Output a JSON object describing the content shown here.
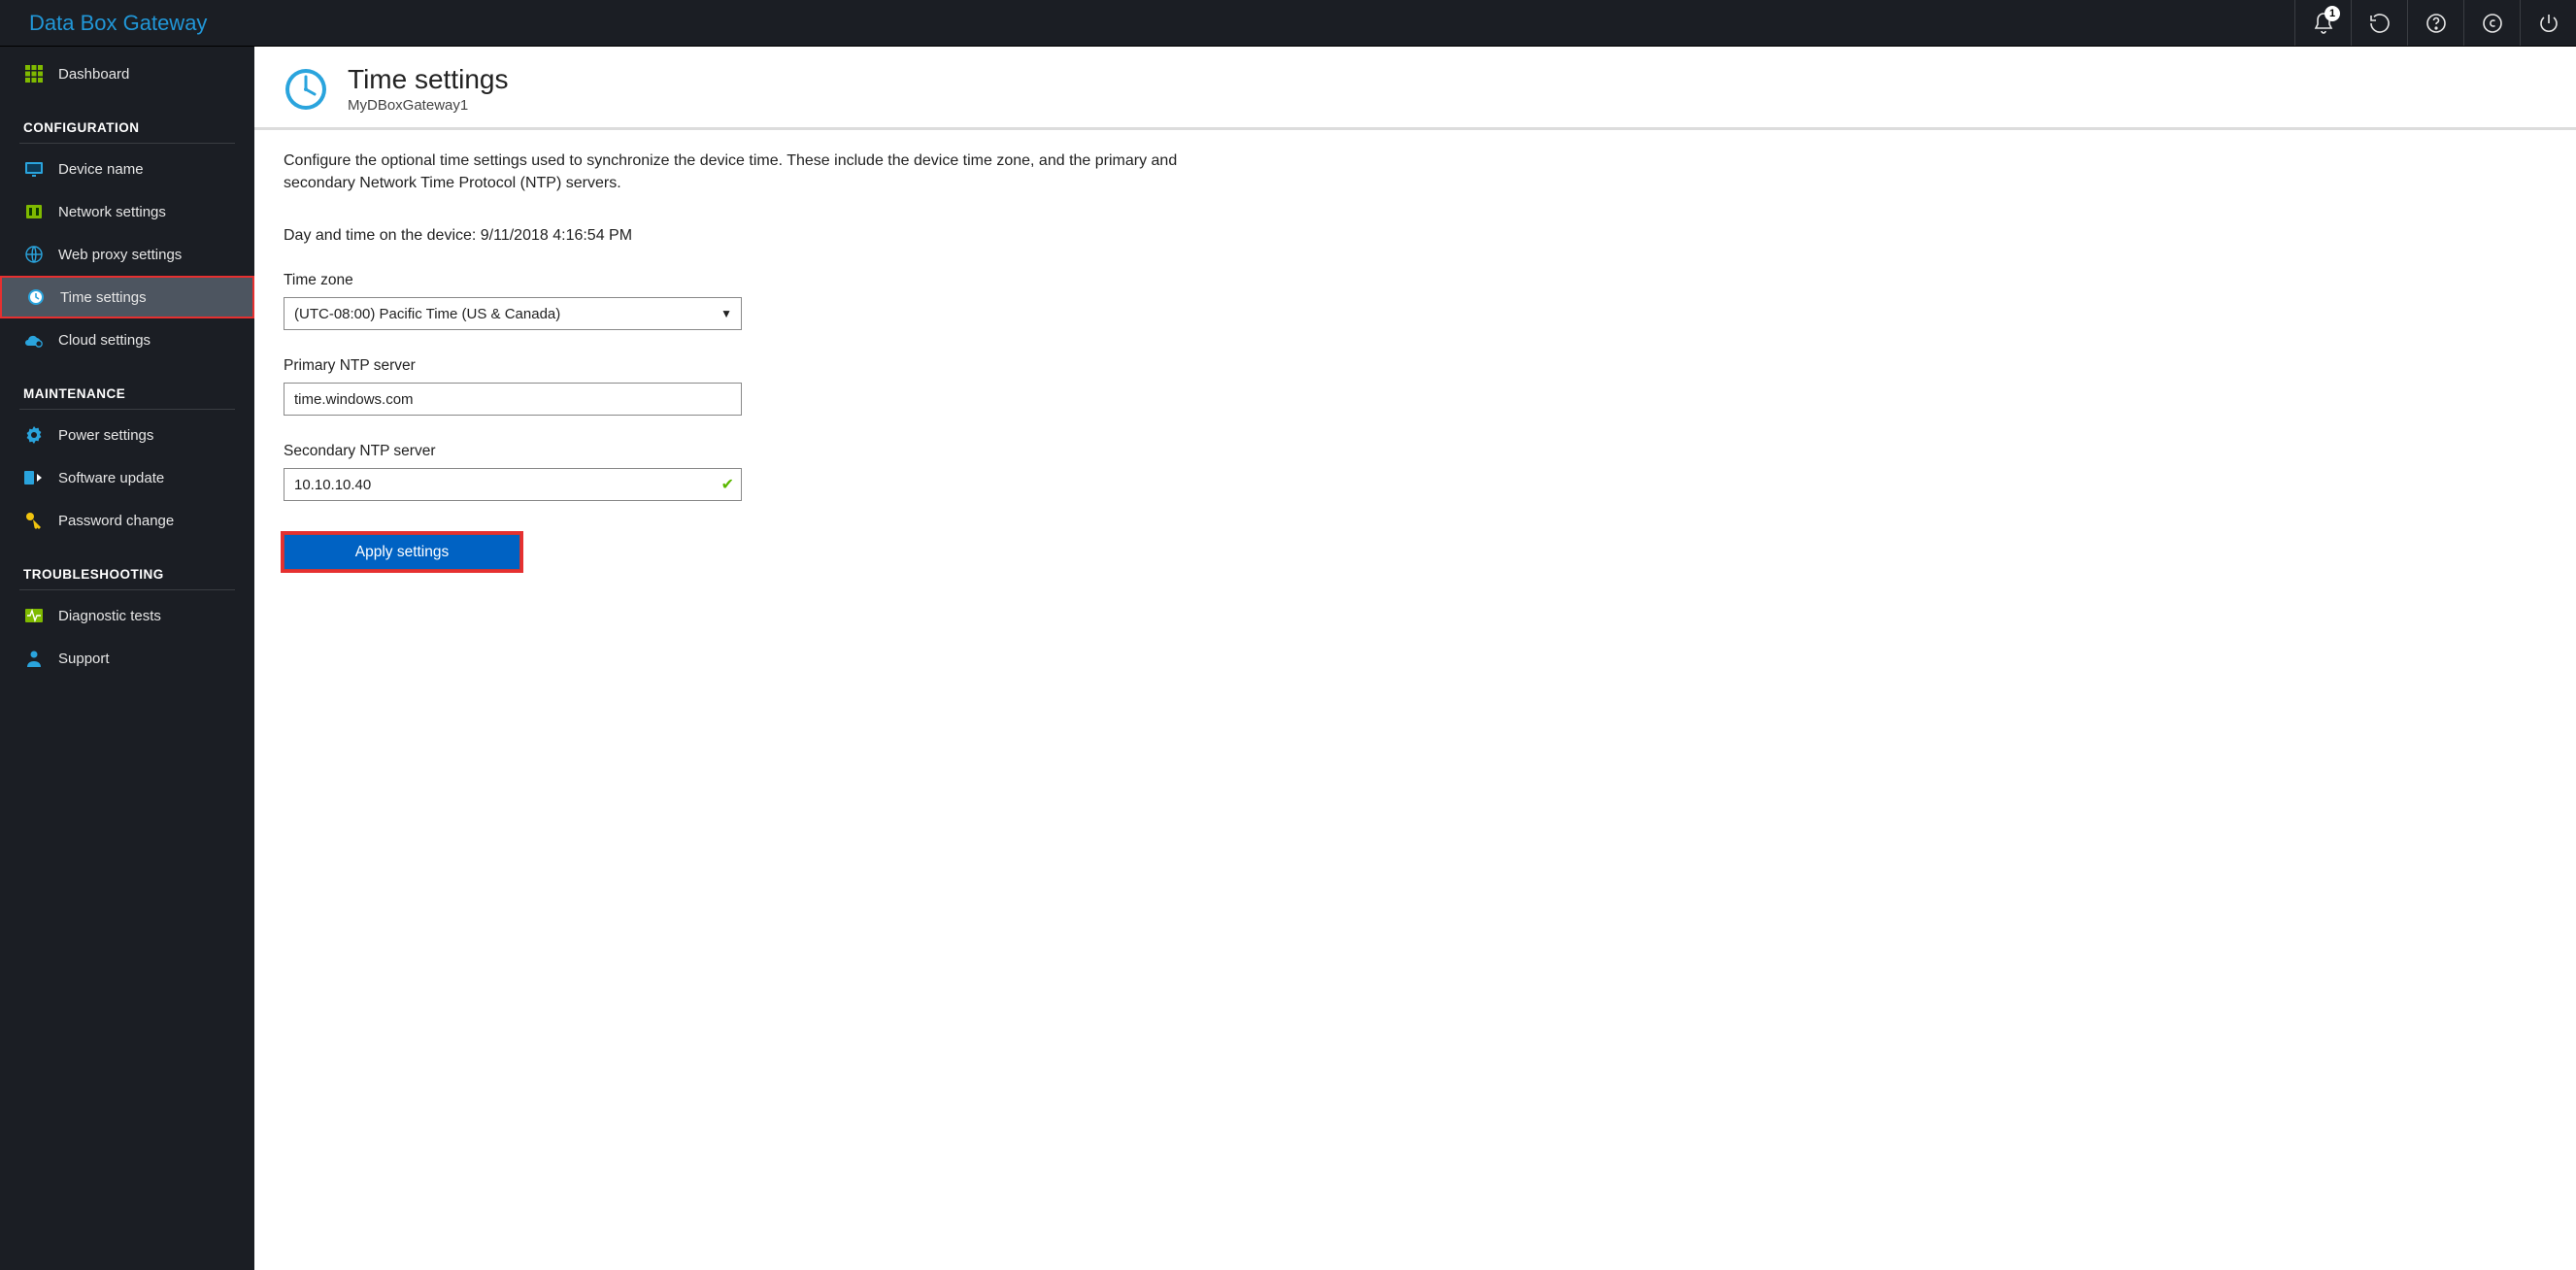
{
  "app_title": "Data Box Gateway",
  "notifications_count": "1",
  "sidebar": {
    "dashboard": "Dashboard",
    "sections": {
      "configuration": "CONFIGURATION",
      "maintenance": "MAINTENANCE",
      "troubleshooting": "TROUBLESHOOTING"
    },
    "items": {
      "device_name": "Device name",
      "network_settings": "Network settings",
      "web_proxy_settings": "Web proxy settings",
      "time_settings": "Time settings",
      "cloud_settings": "Cloud settings",
      "power_settings": "Power settings",
      "software_update": "Software update",
      "password_change": "Password change",
      "diagnostic_tests": "Diagnostic tests",
      "support": "Support"
    }
  },
  "page": {
    "title": "Time settings",
    "subtitle": "MyDBoxGateway1",
    "description": "Configure the optional time settings used to synchronize the device time. These include the device time zone, and the primary and secondary Network Time Protocol (NTP) servers.",
    "device_time_label": "Day and time on the device: 9/11/2018 4:16:54 PM",
    "timezone_label": "Time zone",
    "timezone_value": "(UTC-08:00) Pacific Time (US & Canada)",
    "primary_ntp_label": "Primary NTP server",
    "primary_ntp_value": "time.windows.com",
    "secondary_ntp_label": "Secondary NTP server",
    "secondary_ntp_value": "10.10.10.40",
    "apply_label": "Apply settings"
  }
}
